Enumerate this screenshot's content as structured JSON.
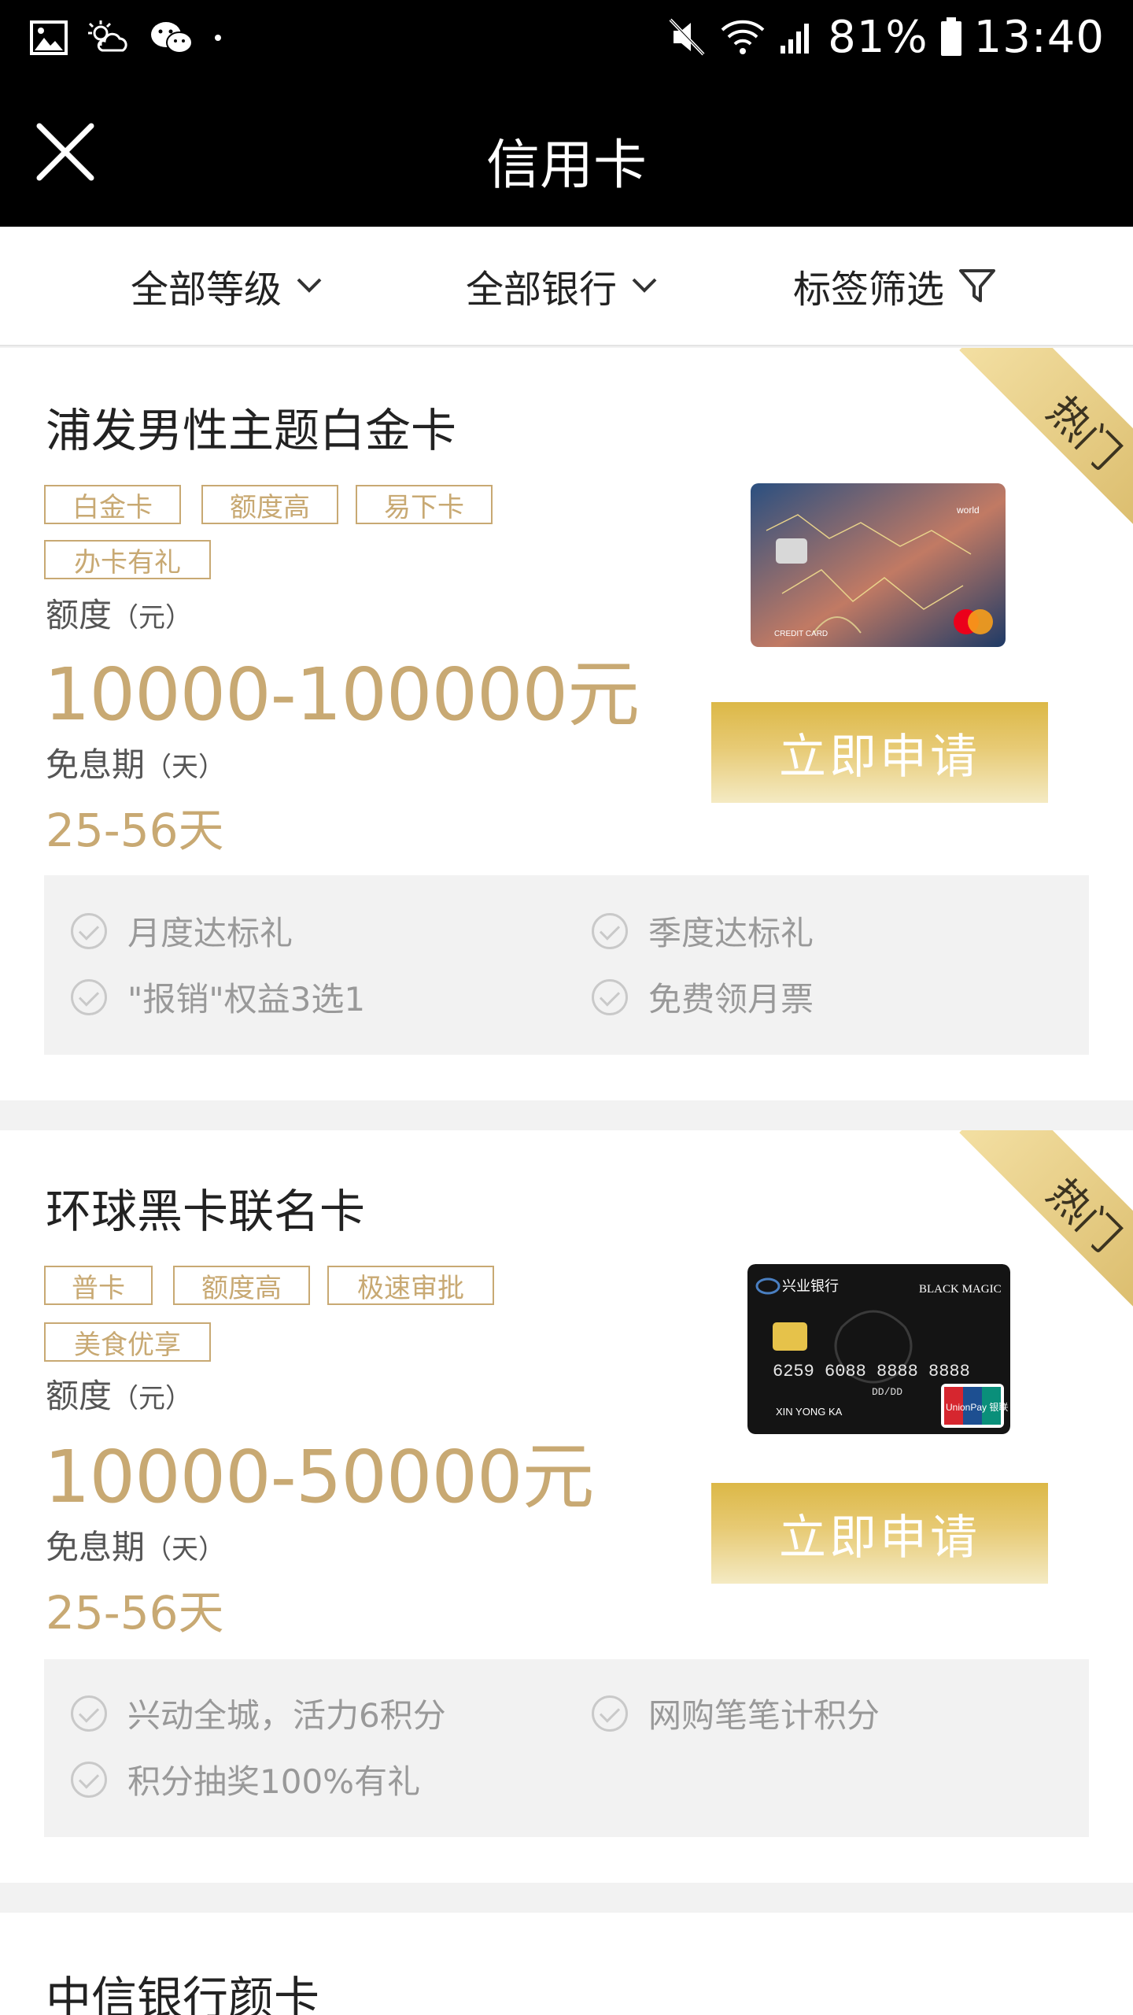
{
  "status_bar": {
    "left_icons": [
      "image-icon",
      "weather-icon",
      "wechat-icon",
      "dot-icon"
    ],
    "right_icons": [
      "mute-icon",
      "wifi-icon",
      "signal-icon",
      "battery-icon"
    ],
    "battery": "81%",
    "time": "13:40"
  },
  "app_bar": {
    "title": "信用卡",
    "close_icon": "close-icon"
  },
  "filters": [
    {
      "label": "全部等级",
      "icon": "chevron-down-icon"
    },
    {
      "label": "全部银行",
      "icon": "chevron-down-icon"
    },
    {
      "label": "标签筛选",
      "icon": "filter-icon"
    }
  ],
  "cards": [
    {
      "title": "浦发男性主题白金卡",
      "badge": "热门",
      "tags": [
        "白金卡",
        "额度高",
        "易下卡",
        "办卡有礼"
      ],
      "limit_label": "额度",
      "limit_unit": "（元）",
      "limit_value": "10000-100000元",
      "free_label": "免息期",
      "free_unit": "（天）",
      "free_value": "25-56天",
      "apply": "立即申请",
      "benefits": [
        "月度达标礼",
        "季度达标礼",
        "\"报销\"权益3选1",
        "免费领月票"
      ],
      "card_image": {
        "brand": "world",
        "label": "CREDIT CARD",
        "colors": [
          "#2a4a78",
          "#c07060",
          "#1e3a66"
        ]
      }
    },
    {
      "title": "环球黑卡联名卡",
      "badge": "热门",
      "tags": [
        "普卡",
        "额度高",
        "极速审批",
        "美食优享"
      ],
      "limit_label": "额度",
      "limit_unit": "（元）",
      "limit_value": "10000-50000元",
      "free_label": "免息期",
      "free_unit": "（天）",
      "free_value": "25-56天",
      "apply": "立即申请",
      "benefits": [
        "兴动全城，活力6积分",
        "网购笔笔计积分",
        "积分抽奖100%有礼"
      ],
      "card_image": {
        "bank": "兴业银行",
        "brand": "BLACK MAGIC",
        "number": "6259 6088 8888 8888",
        "holder": "XIN YONG KA",
        "valid": "DD/DD",
        "network": "UnionPay 银联",
        "colors": [
          "#111111",
          "#2b2b2b"
        ]
      }
    },
    {
      "title": "中信银行颜卡"
    }
  ]
}
